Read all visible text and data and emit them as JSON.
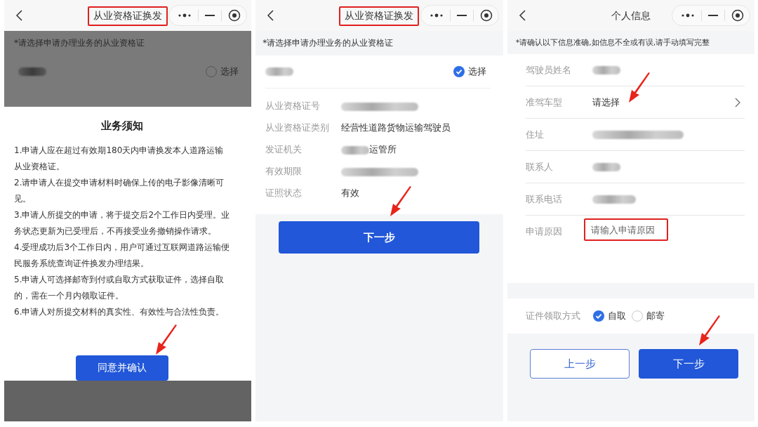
{
  "screens": [
    {
      "kind": "notice",
      "nav": {
        "title": "从业资格证换发",
        "highlighted": true
      },
      "background": {
        "hint": "*请选择申请办理业务的从业资格证",
        "select_label": "选择",
        "selected": false,
        "name_redacted": true
      },
      "dialog": {
        "title": "业务须知",
        "paragraphs": [
          "1.申请人应在超过有效期180天内申请换发本人道路运输从业资格证。",
          "2.请申请人在提交申请材料时确保上传的电子影像清晰可见。",
          "3.申请人所提交的申请，将于提交后2个工作日内受理。业务状态更新为已受理后，不再接受业务撤销操作请求。",
          "4.受理成功后3个工作日内，用户可通过互联网道路运输便民服务系统查询证件换发办理结果。",
          "5.申请人可选择邮寄到付或自取方式获取证件，选择自取的，需在一个月内领取证件。",
          "6.申请人对所提交材料的真实性、有效性与合法性负责。"
        ],
        "button": {
          "label": "同意并确认",
          "arrow": true
        }
      }
    },
    {
      "kind": "certificate",
      "nav": {
        "title": "从业资格证换发",
        "highlighted": true
      },
      "hint": "*请选择申请办理业务的从业资格证",
      "certificate": {
        "name_redacted": true,
        "select_label": "选择",
        "selected": true,
        "fields": [
          {
            "label": "从业资格证号",
            "redacted": true
          },
          {
            "label": "从业资格证类别",
            "value": "经营性道路货物运输驾驶员"
          },
          {
            "label": "发证机关",
            "redacted": true,
            "value": "运管所"
          },
          {
            "label": "有效期限",
            "redacted": true
          },
          {
            "label": "证照状态",
            "value": "有效"
          }
        ]
      },
      "button": {
        "label": "下一步",
        "arrow": true
      }
    },
    {
      "kind": "form",
      "nav": {
        "title": "个人信息",
        "highlighted": false
      },
      "hint": "*请确认以下信息准确,如信息不全或有误,请手动填写完整",
      "fields": [
        {
          "label": "驾驶员姓名",
          "kind": "text",
          "redacted": true
        },
        {
          "label": "准驾车型",
          "kind": "select",
          "value": "请选择",
          "arrow": true
        },
        {
          "label": "住址",
          "kind": "text",
          "redacted": true
        },
        {
          "label": "联系人",
          "kind": "text",
          "redacted": true
        },
        {
          "label": "联系电话",
          "kind": "text",
          "redacted": true
        },
        {
          "label": "申请原因",
          "kind": "input",
          "placeholder": "请输入申请原因",
          "highlighted": true
        }
      ],
      "pickup": {
        "label": "证件领取方式",
        "options": [
          {
            "label": "自取",
            "selected": true
          },
          {
            "label": "邮寄",
            "selected": false
          }
        ]
      },
      "buttons": [
        {
          "label": "上一步",
          "kind": "secondary"
        },
        {
          "label": "下一步",
          "kind": "primary",
          "arrow": true
        }
      ]
    }
  ]
}
